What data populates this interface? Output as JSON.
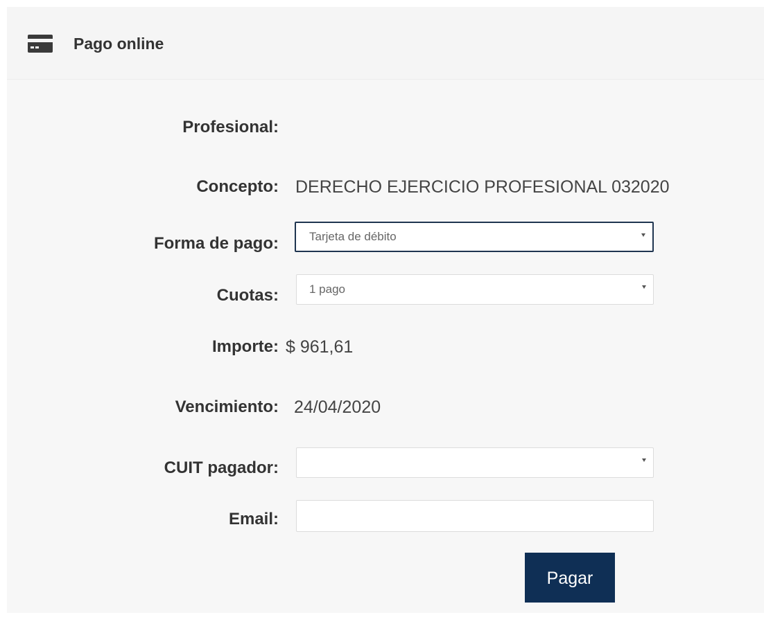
{
  "header": {
    "title": "Pago online",
    "icon": "credit-card-icon"
  },
  "form": {
    "profesional": {
      "label": "Profesional:",
      "value": ""
    },
    "concepto": {
      "label": "Concepto:",
      "value": "DERECHO EJERCICIO PROFESIONAL 032020"
    },
    "forma_pago": {
      "label": "Forma de pago:",
      "selected": "Tarjeta de débito"
    },
    "cuotas": {
      "label": "Cuotas:",
      "selected": "1 pago"
    },
    "importe": {
      "label": "Importe:",
      "value": "$ 961,61"
    },
    "vencimiento": {
      "label": "Vencimiento:",
      "value": "24/04/2020"
    },
    "cuit_pagador": {
      "label": "CUIT pagador:",
      "selected": ""
    },
    "email": {
      "label": "Email:",
      "value": ""
    },
    "submit_label": "Pagar"
  },
  "colors": {
    "button_bg": "#0f2f55",
    "focus_border": "#1f3550",
    "panel_bg": "#f5f5f5"
  }
}
